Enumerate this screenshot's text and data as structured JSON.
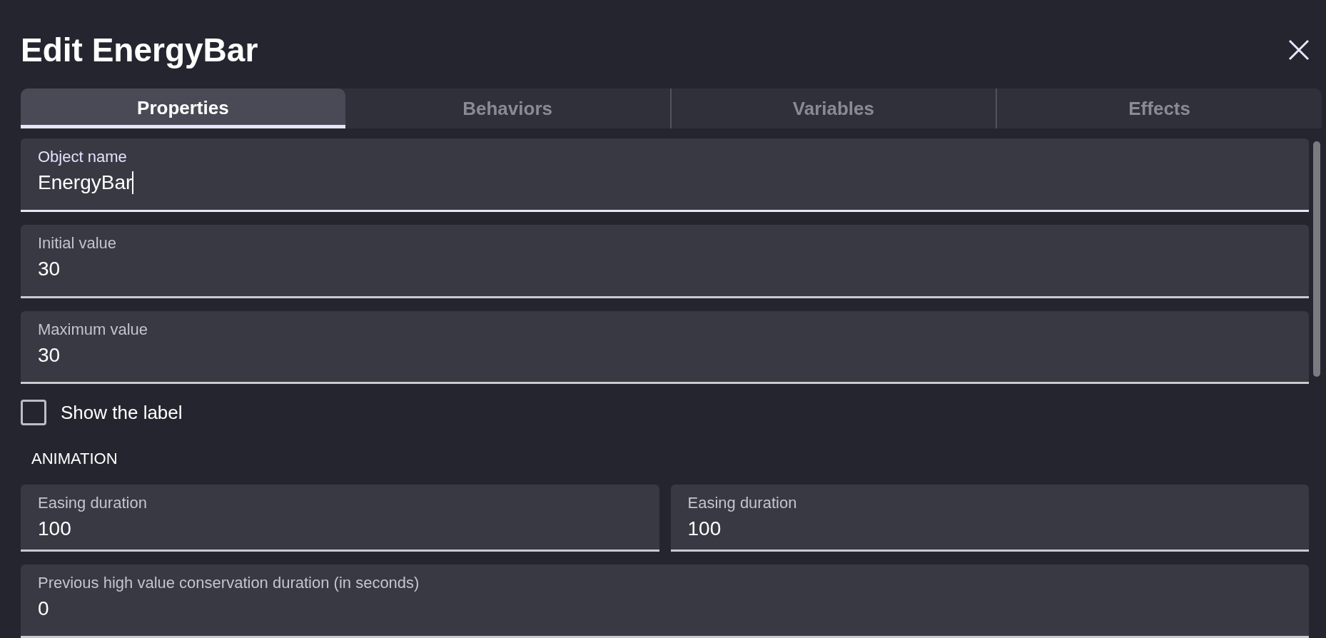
{
  "dialog": {
    "title": "Edit EnergyBar"
  },
  "tabs": [
    {
      "label": "Properties",
      "selected": true
    },
    {
      "label": "Behaviors",
      "selected": false
    },
    {
      "label": "Variables",
      "selected": false
    },
    {
      "label": "Effects",
      "selected": false
    }
  ],
  "items": [
    {
      "kind": "field",
      "label": "Object name",
      "value": "EnergyBar",
      "focused": true
    },
    {
      "kind": "field",
      "label": "Initial value",
      "value": "30",
      "focused": false
    },
    {
      "kind": "field",
      "label": "Maximum value",
      "value": "30",
      "focused": false
    },
    {
      "kind": "checkbox",
      "label": "Show the label",
      "checked": false
    },
    {
      "kind": "section",
      "label": "ANIMATION"
    },
    {
      "kind": "pair",
      "fields": [
        {
          "label": "Easing duration",
          "value": "100",
          "focused": false
        },
        {
          "label": "Easing duration",
          "value": "100",
          "focused": false
        }
      ]
    },
    {
      "kind": "field",
      "label": "Previous high value conservation duration (in seconds)",
      "value": "0",
      "focused": false
    }
  ]
}
